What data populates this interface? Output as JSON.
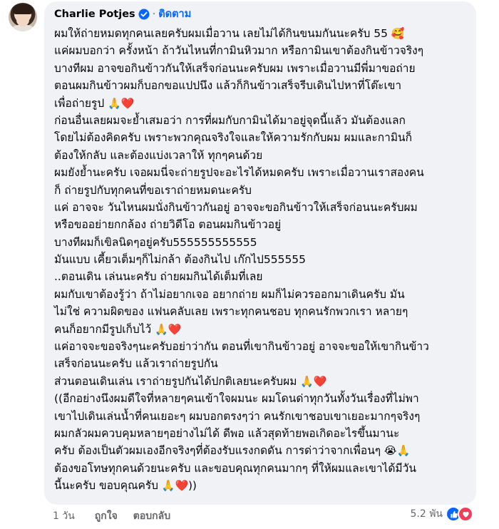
{
  "comment": {
    "author": "Charlie Potjes",
    "separator": "·",
    "follow_label": "ติดตาม",
    "lines": [
      "ผมให้ถ่ายหมดทุกคนเลยครับผมเมื่อวาน เลยไม่ได้กินขนมกันนะครับ 55",
      "แค่ผมบอกว่า ครั้งหน้า ถ้าวันไหนที่กามินหิวมาก หรือกามินเขาต้องกินข้าวจริงๆ",
      "บางทีผม อาจขอกินข้าวกันให้เสร็จก่อนนะครับผม เพราะเมื่อวานมีพี่มาขอถ่าย",
      "ตอนผมกินข้าวผมก็บอกขอแปปนึง แล้วก็กินข้าวเสร็จรีบเดินไปหาที่โต๊ะเขา",
      "เพื่อถ่ายรูป",
      "ก่อนอื่นเลยผมจะย้ำเสมอว่า การที่ผมกับกามินได้มาอยู่จุดนี้แล้ว มันต้องแลก",
      "โดยไม่ต้องคิดครับ เพราะพวกคุณจริงใจและให้ความรักกับผม ผมและกามินก็",
      "ต้องให้กลับ และต้องแบ่งเวลาให้ ทุกๆคนด้วย",
      "ผมยังย้ำนะครับ เจอผมนี่จะถ่ายรูปจะอะไรได้หมดครับ เพราะเมื่อวานเราสองคน",
      "ก็ ถ่ายรูปกับทุกคนที่ขอเราถ่ายหมดนะครับ",
      "แค่ อาจจะ วันไหนผมนั่งกินข้าวกันอยู่ อาจจะขอกินข้าวให้เสร็จก่อนนะครับผม",
      "หรือขออย่ายกกล้อง ถ่ายวิดีโอ ตอนผมกินข้าวอยู่",
      "บางทีผมก็เขิลนิดๆอยู่ครับ555555555555",
      "มันแบบ เคี้ยวเต็มๆก็ไม่กล้า ต้องกินไป เก๊กไป555555",
      "..ตอนเดิน เล่นนะครับ ถ่ายผมกินได้เต็มที่เลย",
      "ผมกับเขาต้องรู้ว่า ถ้าไม่อยากเจอ อยากถ่าย ผมก็ไม่ควรออกมาเดินครับ มัน",
      "ไม่ใช่ ความผิดของ แฟนคลับเลย เพราะทุกคนชอบ ทุกคนรักพวกเรา หลายๆ",
      "คนก็อยากมีรูปเก็บไว้",
      "แค่อาจจะขอจริงๆนะครับอย่าว่ากัน ตอนที่เขากินข้าวอยู่ อาจจะขอให้เขากินข้าว",
      "เสร็จก่อนนะครับ แล้วเราถ่ายรูปกัน",
      "ส่วนตอนเดินเล่น เราถ่ายรูปกันได้ปกติเลยนะครับผม",
      "((อีกอย่างนึงผมดีใจที่หลายๆคนเข้าใจผมนะ ผมโดนด่าทุกวันทั้งวันเรื่องที่ไม่พา",
      "เขาไปเดินเล่นน้ำที่คนเยอะๆ ผมบอกตรงๆว่า คนรักเขาชอบเขาเยอะมากๆจริงๆ",
      "ผมกลัวผมควบคุมหลายๆอย่างไม่ได้ ดีพอ แล้วสุดท้ายพอเกิดอะไรขึ้นมานะ",
      "ครับ ต้องเป็นตัวผมเองอีกจริงๆที่ต้องรับแรงกดดัน การด่าว่าจากเพื่อนๆ",
      "ต้องขอโทษทุกคนด้วยนะครับ และขอบคุณทุกคนมากๆ ที่ให้ผมและเขาได้มีวัน",
      "นี้นะครับ ขอบคุณครับ"
    ],
    "line_emojis": {
      "0": [
        "🥰"
      ],
      "4": [
        "🙏",
        "❤️"
      ],
      "17": [
        "🙏",
        "❤️"
      ],
      "20": [
        "🙏",
        "❤️"
      ],
      "24": [
        "😭",
        "🙏"
      ],
      "26": [
        "🙏",
        "❤️",
        "))"
      ]
    },
    "footer": {
      "time": "1 วัน",
      "like_label": "ถูกใจ",
      "reply_label": "ตอบกลับ",
      "reaction_count": "5.2 พัน"
    }
  },
  "colors": {
    "bubble": "#f0f2f5",
    "link": "#0866ff",
    "meta": "#65676b",
    "heart": "#e41e3f"
  }
}
